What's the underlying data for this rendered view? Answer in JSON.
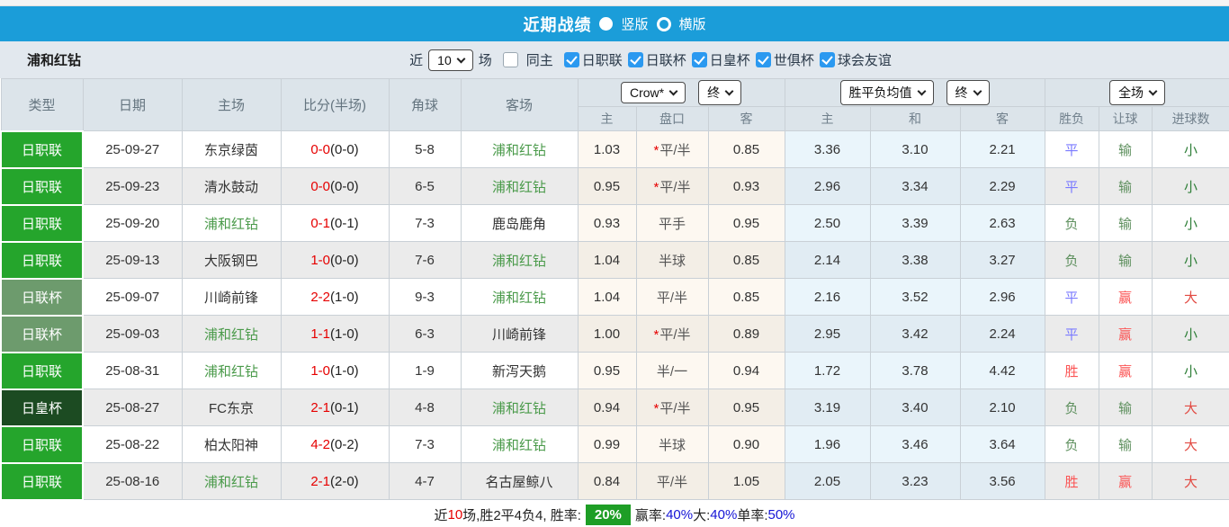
{
  "titlebar": {
    "title": "近期战绩",
    "options": [
      {
        "label": "竖版",
        "selected": true
      },
      {
        "label": "横版",
        "selected": false
      }
    ]
  },
  "filterbar": {
    "team": "浦和红钻",
    "recent_label": "近",
    "count_value": "10",
    "unit_label": "场",
    "same_home_label": "同主",
    "leagues": [
      {
        "label": "日职联",
        "checked": true
      },
      {
        "label": "日联杯",
        "checked": true
      },
      {
        "label": "日皇杯",
        "checked": true
      },
      {
        "label": "世俱杯",
        "checked": true
      },
      {
        "label": "球会友谊",
        "checked": true
      }
    ]
  },
  "table": {
    "main_headers": [
      "类型",
      "日期",
      "主场",
      "比分(半场)",
      "角球",
      "客场"
    ],
    "dropdowns": {
      "bookmaker": "Crow*",
      "ah_time": "终",
      "europe": "胜平负均值",
      "eu_time": "终",
      "scope": "全场"
    },
    "sub_headers": [
      "主",
      "盘口",
      "客",
      "主",
      "和",
      "客",
      "胜负",
      "让球",
      "进球数"
    ],
    "rows": [
      {
        "type": "日职联",
        "type_key": "j1",
        "date": "25-09-27",
        "home": "东京绿茵",
        "home_self": false,
        "score": "0-0",
        "half": "(0-0)",
        "corner": "5-8",
        "away": "浦和红钻",
        "away_self": true,
        "ah_home": "1.03",
        "ah_star": true,
        "ah_line": "平/半",
        "ah_away": "0.85",
        "eu_home": "3.36",
        "eu_draw": "3.10",
        "eu_away": "2.21",
        "result": "平",
        "result_key": "draw",
        "handicap": "输",
        "handicap_key": "lose",
        "goals": "小",
        "goals_key": "small"
      },
      {
        "type": "日职联",
        "type_key": "j1",
        "date": "25-09-23",
        "home": "清水鼓动",
        "home_self": false,
        "score": "0-0",
        "half": "(0-0)",
        "corner": "6-5",
        "away": "浦和红钻",
        "away_self": true,
        "ah_home": "0.95",
        "ah_star": true,
        "ah_line": "平/半",
        "ah_away": "0.93",
        "eu_home": "2.96",
        "eu_draw": "3.34",
        "eu_away": "2.29",
        "result": "平",
        "result_key": "draw",
        "handicap": "输",
        "handicap_key": "lose",
        "goals": "小",
        "goals_key": "small"
      },
      {
        "type": "日职联",
        "type_key": "j1",
        "date": "25-09-20",
        "home": "浦和红钻",
        "home_self": true,
        "score": "0-1",
        "half": "(0-1)",
        "corner": "7-3",
        "away": "鹿岛鹿角",
        "away_self": false,
        "ah_home": "0.93",
        "ah_star": false,
        "ah_line": "平手",
        "ah_away": "0.95",
        "eu_home": "2.50",
        "eu_draw": "3.39",
        "eu_away": "2.63",
        "result": "负",
        "result_key": "lose",
        "handicap": "输",
        "handicap_key": "lose",
        "goals": "小",
        "goals_key": "small"
      },
      {
        "type": "日职联",
        "type_key": "j1",
        "date": "25-09-13",
        "home": "大阪钢巴",
        "home_self": false,
        "score": "1-0",
        "half": "(0-0)",
        "corner": "7-6",
        "away": "浦和红钻",
        "away_self": true,
        "ah_home": "1.04",
        "ah_star": false,
        "ah_line": "半球",
        "ah_away": "0.85",
        "eu_home": "2.14",
        "eu_draw": "3.38",
        "eu_away": "3.27",
        "result": "负",
        "result_key": "lose",
        "handicap": "输",
        "handicap_key": "lose",
        "goals": "小",
        "goals_key": "small"
      },
      {
        "type": "日联杯",
        "type_key": "cup",
        "date": "25-09-07",
        "home": "川崎前锋",
        "home_self": false,
        "score": "2-2",
        "half": "(1-0)",
        "corner": "9-3",
        "away": "浦和红钻",
        "away_self": true,
        "ah_home": "1.04",
        "ah_star": false,
        "ah_line": "平/半",
        "ah_away": "0.85",
        "eu_home": "2.16",
        "eu_draw": "3.52",
        "eu_away": "2.96",
        "result": "平",
        "result_key": "draw",
        "handicap": "赢",
        "handicap_key": "win",
        "goals": "大",
        "goals_key": "big"
      },
      {
        "type": "日联杯",
        "type_key": "cup",
        "date": "25-09-03",
        "home": "浦和红钻",
        "home_self": true,
        "score": "1-1",
        "half": "(1-0)",
        "corner": "6-3",
        "away": "川崎前锋",
        "away_self": false,
        "ah_home": "1.00",
        "ah_star": true,
        "ah_line": "平/半",
        "ah_away": "0.89",
        "eu_home": "2.95",
        "eu_draw": "3.42",
        "eu_away": "2.24",
        "result": "平",
        "result_key": "draw",
        "handicap": "赢",
        "handicap_key": "win",
        "goals": "小",
        "goals_key": "small"
      },
      {
        "type": "日职联",
        "type_key": "j1",
        "date": "25-08-31",
        "home": "浦和红钻",
        "home_self": true,
        "score": "1-0",
        "half": "(1-0)",
        "corner": "1-9",
        "away": "新泻天鹅",
        "away_self": false,
        "ah_home": "0.95",
        "ah_star": false,
        "ah_line": "半/一",
        "ah_away": "0.94",
        "eu_home": "1.72",
        "eu_draw": "3.78",
        "eu_away": "4.42",
        "result": "胜",
        "result_key": "win",
        "handicap": "赢",
        "handicap_key": "win",
        "goals": "小",
        "goals_key": "small"
      },
      {
        "type": "日皇杯",
        "type_key": "emperor",
        "date": "25-08-27",
        "home": "FC东京",
        "home_self": false,
        "score": "2-1",
        "half": "(0-1)",
        "corner": "4-8",
        "away": "浦和红钻",
        "away_self": true,
        "ah_home": "0.94",
        "ah_star": true,
        "ah_line": "平/半",
        "ah_away": "0.95",
        "eu_home": "3.19",
        "eu_draw": "3.40",
        "eu_away": "2.10",
        "result": "负",
        "result_key": "lose",
        "handicap": "输",
        "handicap_key": "lose",
        "goals": "大",
        "goals_key": "big"
      },
      {
        "type": "日职联",
        "type_key": "j1",
        "date": "25-08-22",
        "home": "柏太阳神",
        "home_self": false,
        "score": "4-2",
        "half": "(0-2)",
        "corner": "7-3",
        "away": "浦和红钻",
        "away_self": true,
        "ah_home": "0.99",
        "ah_star": false,
        "ah_line": "半球",
        "ah_away": "0.90",
        "eu_home": "1.96",
        "eu_draw": "3.46",
        "eu_away": "3.64",
        "result": "负",
        "result_key": "lose",
        "handicap": "输",
        "handicap_key": "lose",
        "goals": "大",
        "goals_key": "big"
      },
      {
        "type": "日职联",
        "type_key": "j1",
        "date": "25-08-16",
        "home": "浦和红钻",
        "home_self": true,
        "score": "2-1",
        "half": "(2-0)",
        "corner": "4-7",
        "away": "名古屋鲸八",
        "away_self": false,
        "ah_home": "0.84",
        "ah_star": false,
        "ah_line": "平/半",
        "ah_away": "1.05",
        "eu_home": "2.05",
        "eu_draw": "3.23",
        "eu_away": "3.56",
        "result": "胜",
        "result_key": "win",
        "handicap": "赢",
        "handicap_key": "win",
        "goals": "大",
        "goals_key": "big"
      }
    ]
  },
  "footer": {
    "segments": [
      {
        "text": "近",
        "style": "plain"
      },
      {
        "text": "10",
        "style": "red"
      },
      {
        "text": "场,胜2平4负4, 胜率:",
        "style": "plain"
      },
      {
        "text": "20%",
        "style": "badge"
      },
      {
        "text": " 赢率:",
        "style": "plain"
      },
      {
        "text": "40%",
        "style": "blue"
      },
      {
        "text": " 大:",
        "style": "plain"
      },
      {
        "text": "40%",
        "style": "blue"
      },
      {
        "text": " 单率:",
        "style": "plain"
      },
      {
        "text": "50%",
        "style": "blue"
      }
    ]
  }
}
